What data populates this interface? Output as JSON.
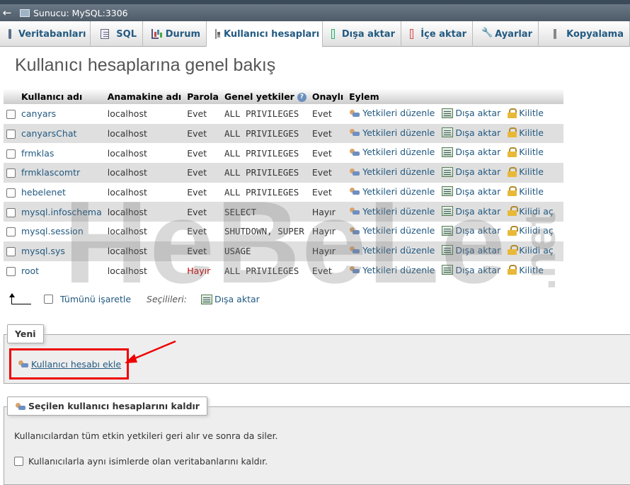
{
  "server_bar": {
    "back": "←",
    "title": "Sunucu: MySQL:3306"
  },
  "tabs": [
    {
      "label": "Veritabanları",
      "icon": "database-icon"
    },
    {
      "label": "SQL",
      "icon": "sql-icon"
    },
    {
      "label": "Durum",
      "icon": "status-icon"
    },
    {
      "label": "Kullanıcı hesapları",
      "icon": "users-icon",
      "active": true
    },
    {
      "label": "Dışa aktar",
      "icon": "export-icon"
    },
    {
      "label": "İçe aktar",
      "icon": "import-icon"
    },
    {
      "label": "Ayarlar",
      "icon": "wrench-icon"
    },
    {
      "label": "Kopyalama",
      "icon": "replication-icon"
    }
  ],
  "page_title": "Kullanıcı hesaplarına genel bakış",
  "table": {
    "headers": [
      "Kullanıcı adı",
      "Anamakine adı",
      "Parola",
      "Genel yetkiler",
      "Onaylı",
      "Eylem"
    ],
    "help_icon": "?",
    "actions": {
      "edit": "Yetkileri düzenle",
      "export": "Dışa aktar",
      "lock": "Kilitle",
      "unlock": "Kilidi aç"
    },
    "rows": [
      {
        "user": "canyars",
        "host": "localhost",
        "password": "Evet",
        "privileges": "ALL PRIVILEGES",
        "granted": "Evet",
        "lock": "Kilitle"
      },
      {
        "user": "canyarsChat",
        "host": "localhost",
        "password": "Evet",
        "privileges": "ALL PRIVILEGES",
        "granted": "Evet",
        "lock": "Kilitle"
      },
      {
        "user": "frmklas",
        "host": "localhost",
        "password": "Evet",
        "privileges": "ALL PRIVILEGES",
        "granted": "Evet",
        "lock": "Kilitle"
      },
      {
        "user": "frmklascomtr",
        "host": "localhost",
        "password": "Evet",
        "privileges": "ALL PRIVILEGES",
        "granted": "Evet",
        "lock": "Kilitle"
      },
      {
        "user": "hebelenet",
        "host": "localhost",
        "password": "Evet",
        "privileges": "ALL PRIVILEGES",
        "granted": "Evet",
        "lock": "Kilitle"
      },
      {
        "user": "mysql.infoschema",
        "host": "localhost",
        "password": "Evet",
        "privileges": "SELECT",
        "granted": "Hayır",
        "lock": "Kilidi aç"
      },
      {
        "user": "mysql.session",
        "host": "localhost",
        "password": "Evet",
        "privileges": "SHUTDOWN, SUPER",
        "granted": "Hayır",
        "lock": "Kilidi aç"
      },
      {
        "user": "mysql.sys",
        "host": "localhost",
        "password": "Evet",
        "privileges": "USAGE",
        "granted": "Hayır",
        "lock": "Kilidi aç"
      },
      {
        "user": "root",
        "host": "localhost",
        "password": "Hayır",
        "privileges": "ALL PRIVILEGES",
        "granted": "Evet",
        "lock": "Kilitle"
      }
    ]
  },
  "bulk": {
    "check_all": "Tümünü işaretle",
    "with_selected": "Seçilileri:",
    "export": "Dışa aktar"
  },
  "new_section": {
    "legend": "Yeni",
    "add_user": "Kullanıcı hesabı ekle"
  },
  "remove_section": {
    "legend": "Seçilen kullanıcı hesaplarını kaldır",
    "description": "Kullanıcılardan tüm etkin yetkileri geri alır ve sonra da siler.",
    "option": "Kullanıcılarla aynı isimlerde olan veritabanlarını kaldır."
  },
  "watermark": {
    "main": "HeBeLe",
    "sub": ".net"
  },
  "colors": {
    "link": "#235a81",
    "highlight_box": "#e00000",
    "row_alt": "#dfdfdf"
  }
}
